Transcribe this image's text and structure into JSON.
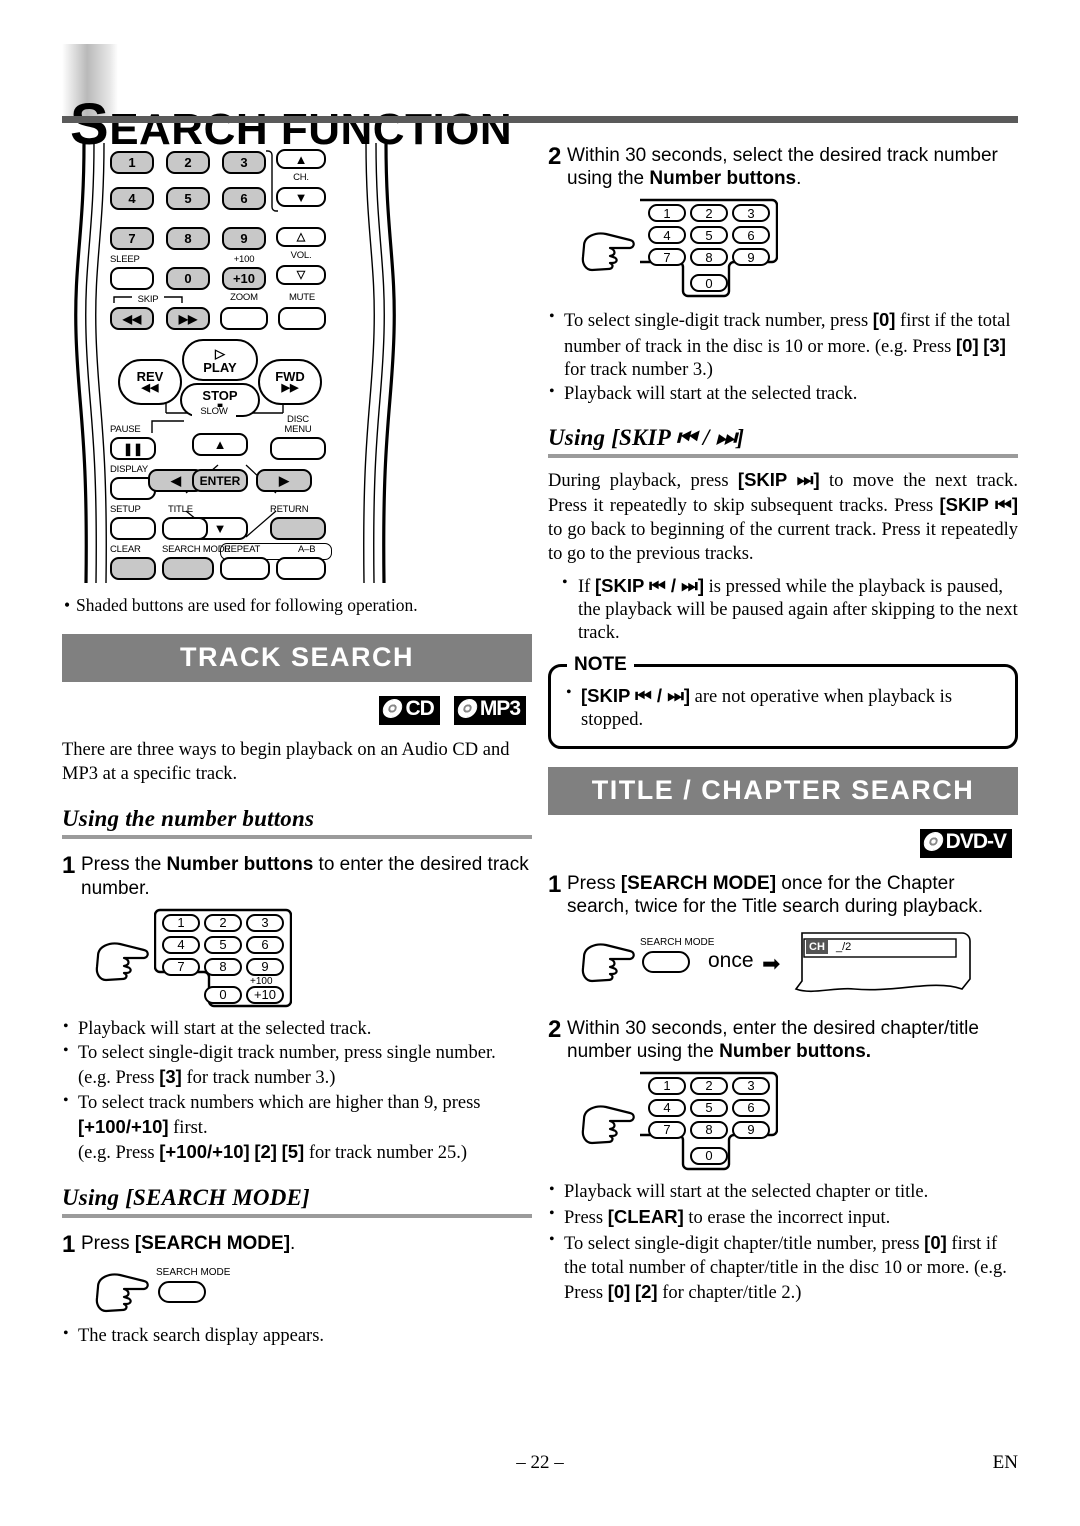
{
  "header": {
    "title_cap": "S",
    "title_rest": "EARCH FUNCTION"
  },
  "remote": {
    "shaded_note": "Shaded buttons are used for following operation.",
    "keys": [
      {
        "label": "1",
        "shaded": true
      },
      {
        "label": "2",
        "shaded": true
      },
      {
        "label": "3",
        "shaded": true
      },
      {
        "label": "4",
        "shaded": true
      },
      {
        "label": "5",
        "shaded": true
      },
      {
        "label": "6",
        "shaded": true
      },
      {
        "label": "7",
        "shaded": true
      },
      {
        "label": "8",
        "shaded": true
      },
      {
        "label": "9",
        "shaded": true
      },
      {
        "label": "0",
        "shaded": true
      },
      {
        "label": "+10",
        "shaded": true
      }
    ],
    "labels": {
      "ch": "CH.",
      "vol": "VOL.",
      "sleep": "SLEEP",
      "plus100": "+100",
      "skip": "SKIP",
      "zoom": "ZOOM",
      "mute": "MUTE",
      "play": "PLAY",
      "rev": "REV",
      "fwd": "FWD",
      "stop": "STOP",
      "slow": "SLOW",
      "pause": "PAUSE",
      "disc_menu_line1": "DISC",
      "disc_menu_line2": "MENU",
      "display": "DISPLAY",
      "enter": "ENTER",
      "setup": "SETUP",
      "title": "TITLE",
      "return": "RETURN",
      "clear": "CLEAR",
      "search_mode": "SEARCH MODE",
      "repeat": "REPEAT",
      "ab": "A–B",
      "skip_prev": "⏮",
      "skip_next": "⏭"
    }
  },
  "track_search": {
    "bar_title": "TRACK SEARCH",
    "logos": [
      "CD",
      "MP3"
    ],
    "intro": "There are three ways to begin playback on an Audio CD and MP3 at a specific track.",
    "sub_number": "Using the number buttons",
    "step1_no": "1",
    "step1_a": "Press the ",
    "step1_b": "Number buttons",
    "step1_c": " to enter the desired track number.",
    "keypad_keys": [
      "1",
      "2",
      "3",
      "4",
      "5",
      "6",
      "7",
      "8",
      "9",
      "0",
      "+10"
    ],
    "keypad_tag": "+100",
    "bullets": [
      "Playback will start at the selected track.",
      "To select single-digit track number, press single number. (e.g. Press [3] for track number 3.)",
      "To select track numbers which are higher than 9, press [+100/+10] first."
    ],
    "bullet2_pre": "To select single-digit track number, press single number. (e.g. Press ",
    "bullet2_key": "[3]",
    "bullet2_post": " for track number 3.)",
    "bullet3_pre": "To select track numbers which are higher than 9, press ",
    "bullet3_key": "[+100/+10]",
    "bullet3_post": " first.",
    "bullet3_line2_pre": "(e.g. Press ",
    "bullet3_line2_k1": "[+100/+10]",
    "bullet3_line2_k2": "[2]",
    "bullet3_line2_k3": "[5]",
    "bullet3_line2_post": " for track number 25.)",
    "sub_searchmode": "Using [SEARCH MODE]",
    "sm_step1_no": "1",
    "sm_step1_a": "Press ",
    "sm_step1_b": "[SEARCH MODE]",
    "sm_step1_c": ".",
    "sm_button_label": "SEARCH MODE",
    "sm_bullet": "The track search display appears.",
    "step2_no": "2",
    "step2_a": "Within 30 seconds, select the desired track number using the ",
    "step2_b": "Number buttons",
    "step2_c": ".",
    "step2_keypad_keys": [
      "1",
      "2",
      "3",
      "4",
      "5",
      "6",
      "7",
      "8",
      "9",
      "0"
    ],
    "step2_b1_pre": "To select single-digit track number, press ",
    "step2_b1_k1": "[0]",
    "step2_b1_mid": " first if the total number of track in the disc is 10 or more. (e.g. Press ",
    "step2_b1_k2": "[0]",
    "step2_b1_k3": "[3]",
    "step2_b1_post": " for track number 3.)",
    "step2_b2": "Playback will start at the selected track."
  },
  "skip_section": {
    "sub_title": "Using [SKIP ⏮ / ⏭]",
    "para_1": "During playback, press ",
    "para_k1": "[SKIP ⏭]",
    "para_2": " to move the next track. Press it repeatedly to skip subsequent tracks. Press ",
    "para_k2": "[SKIP ⏮]",
    "para_3": " to go back to beginning of the current track. Press it repeatedly to go to the previous tracks.",
    "bullet_pre": "If ",
    "bullet_key": "[SKIP ⏮ / ⏭]",
    "bullet_post": " is pressed while the playback is paused, the playback will be paused again after skipping to the next track.",
    "note_label": "NOTE",
    "note_key": "[SKIP ⏮ / ⏭]",
    "note_post": " are not operative when playback is stopped."
  },
  "title_chapter": {
    "bar_title": "TITLE / CHAPTER SEARCH",
    "logo": "DVD-V",
    "step1_no": "1",
    "step1_a": "Press ",
    "step1_b": "[SEARCH MODE]",
    "step1_c": " once for the Chapter search, twice for the Title search during playback.",
    "sm_button_label": "SEARCH MODE",
    "once_label": "once",
    "osd_chip": "CH",
    "osd_value": "_/2",
    "step2_no": "2",
    "step2_a": "Within 30 seconds, enter the desired chapter/title number using the ",
    "step2_b": "Number buttons.",
    "keypad_keys": [
      "1",
      "2",
      "3",
      "4",
      "5",
      "6",
      "7",
      "8",
      "9",
      "0"
    ],
    "b1": "Playback will start at the selected chapter or title.",
    "b2_pre": "Press ",
    "b2_key": "[CLEAR]",
    "b2_post": " to erase the incorrect input.",
    "b3_pre": "To select single-digit chapter/title number, press ",
    "b3_k1": "[0]",
    "b3_mid": " first if the total number of chapter/title in the disc 10 or more. (e.g. Press ",
    "b3_k2": "[0]",
    "b3_k3": "[2]",
    "b3_post": " for chapter/title 2.)"
  },
  "footer": {
    "page_number": "– 22 –",
    "lang": "EN"
  },
  "colors": {
    "section_bar": "#808080",
    "rule": "#5a5a5a",
    "sub_rule": "#9b9b9b",
    "shaded_key": "#c8c8c8"
  }
}
